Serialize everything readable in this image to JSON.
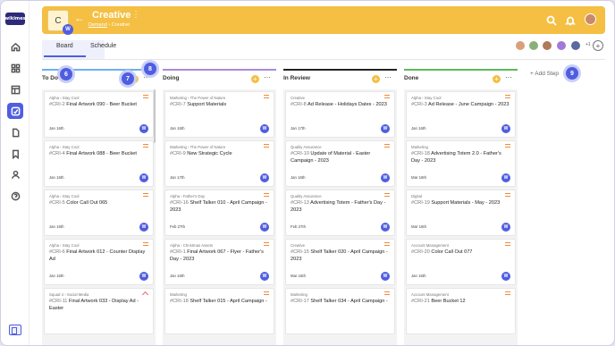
{
  "app": {
    "logo": "wikimes"
  },
  "header": {
    "card_letter": "C",
    "card_user": "W",
    "back_icon": "←",
    "title": "Creative",
    "more": "⋮",
    "breadcrumb": {
      "parent": "Demand",
      "sep": "›",
      "current": "Creative"
    }
  },
  "tabs": [
    {
      "label": "Board",
      "active": true
    },
    {
      "label": "Schedule",
      "active": false
    }
  ],
  "members": {
    "more": "+1",
    "add": "+"
  },
  "columns": [
    {
      "title": "To Do",
      "color": "#6ab0f0",
      "add": "+",
      "more": "···",
      "cards": [
        {
          "sub": "Alpha › Stay Cool",
          "id": "#CRI-2",
          "title": "Final Artwork 090 - Beer Bucket",
          "date": "Jan 16th",
          "user": "W",
          "priority": "med"
        },
        {
          "sub": "Alpha › Stay Cool",
          "id": "#CRI-4",
          "title": "Final Artwork 088 - Beer Bucket",
          "date": "Jan 16th",
          "user": "W",
          "priority": "med"
        },
        {
          "sub": "Alpha › Stay Cool",
          "id": "#CRI-5",
          "title": "Color Call Out 065",
          "date": "Jan 16th",
          "user": "W",
          "priority": "med"
        },
        {
          "sub": "Alpha › Stay Cool",
          "id": "#CRI-6",
          "title": "Final Artwork 012 - Counter Display Ad",
          "date": "Jan 16th",
          "user": "W",
          "priority": "med"
        },
        {
          "sub": "Squad 4 › Social Media",
          "id": "#CRI-11",
          "title": "Final Artwork 033 - Display Ad - Easter",
          "date": "",
          "user": "",
          "priority": "high"
        }
      ]
    },
    {
      "title": "Doing",
      "color": "#a98ad9",
      "add": "+",
      "more": "···",
      "cards": [
        {
          "sub": "Marketing › The Power of Nature",
          "id": "#CRI-7",
          "title": "Support Materials",
          "date": "Jan 16th",
          "user": "W",
          "priority": "med"
        },
        {
          "sub": "Marketing › The Power of Nature",
          "id": "#CRI-9",
          "title": "New Strategic Cycle",
          "date": "Jan 17th",
          "user": "W",
          "priority": "med"
        },
        {
          "sub": "Alpha › Father's Day",
          "id": "#CRI-16",
          "title": "Shelf Talker 010 - April Campaign - 2023",
          "date": "Feb 27th",
          "user": "W",
          "priority": "med"
        },
        {
          "sub": "Alpha › Christmas Assets",
          "id": "#CRI-1",
          "title": "Final Artwork 067 - Flyer - Father's Day - 2023",
          "date": "Jan 16th",
          "user": "W",
          "priority": "med"
        },
        {
          "sub": "Marketing",
          "id": "#CRI-18",
          "title": "Shelf Talker 015 - April Campaign -",
          "date": "",
          "user": "",
          "priority": "med"
        }
      ]
    },
    {
      "title": "In Review",
      "color": "#222222",
      "add": "+",
      "more": "···",
      "cards": [
        {
          "sub": "Creative",
          "id": "#CRI-8",
          "title": "Ad Release - Holidays Dates - 2023",
          "date": "Jan 17th",
          "user": "W",
          "priority": "med"
        },
        {
          "sub": "Quality Assurance",
          "id": "#CRI-10",
          "title": "Update of Material - Easter Campaign - 2023",
          "date": "Jan 16th",
          "user": "W",
          "priority": "med"
        },
        {
          "sub": "Quality Assurance",
          "id": "#CRI-13",
          "title": "Advertising Totem - Father's Day - 2023",
          "date": "Feb 27th",
          "user": "W",
          "priority": "med"
        },
        {
          "sub": "Creative",
          "id": "#CRI-15",
          "title": "Shelf Talker 020 - April Campaign - 2023",
          "date": "Mar 16th",
          "user": "W",
          "priority": "med"
        },
        {
          "sub": "Marketing",
          "id": "#CRI-17",
          "title": "Shelf Talker 034 - April Campaign -",
          "date": "",
          "user": "",
          "priority": "med"
        }
      ]
    },
    {
      "title": "Done",
      "color": "#5cb85c",
      "add": "+",
      "more": "···",
      "cards": [
        {
          "sub": "Alpha › Stay Cool",
          "id": "#CRI-3",
          "title": "Ad Release - June Campaign - 2023",
          "date": "Jan 16th",
          "user": "W",
          "priority": "med"
        },
        {
          "sub": "Marketing",
          "id": "#CRI-18",
          "title": "Advertising Totem 2.0 - Father's Day - 2023",
          "date": "Mar 16th",
          "user": "W",
          "priority": "med"
        },
        {
          "sub": "Digital",
          "id": "#CRI-19",
          "title": "Support Materials - May - 2023",
          "date": "Mar 16th",
          "user": "W",
          "priority": "med"
        },
        {
          "sub": "Account Management",
          "id": "#CRI-20",
          "title": "Color Call Out 077",
          "date": "Jan 16th",
          "user": "W",
          "priority": "med"
        },
        {
          "sub": "Account Management",
          "id": "#CRI-21",
          "title": "Beer Bucket 12",
          "date": "",
          "user": "",
          "priority": "med"
        }
      ]
    }
  ],
  "add_step": "+ Add Step",
  "badges": [
    "6",
    "7",
    "8",
    "9"
  ],
  "colors": {
    "accent": "#4f5ee0",
    "header": "#f4bf42"
  }
}
